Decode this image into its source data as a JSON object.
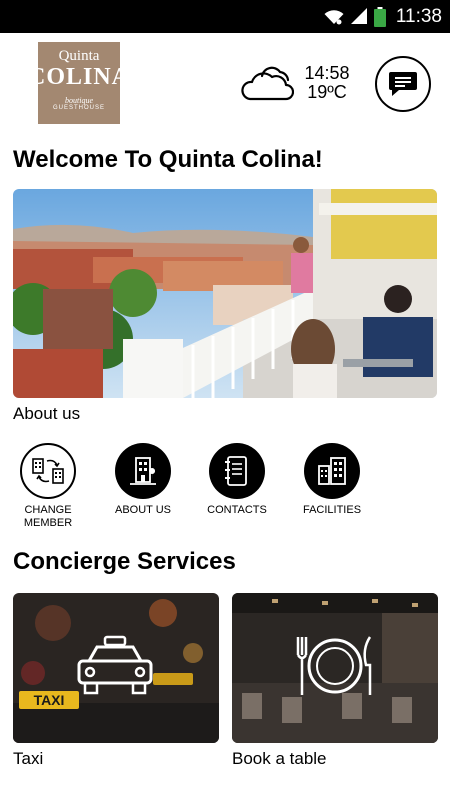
{
  "status_bar": {
    "time": "11:38",
    "icons": [
      "wifi-icon",
      "signal-icon",
      "battery-icon"
    ],
    "battery_color": "#3aa845"
  },
  "header": {
    "logo": {
      "line1": "Quinta",
      "line2": "COLINA",
      "line3": "boutique",
      "line4": "GUESTHOUSE",
      "color": "#a38871"
    },
    "weather": {
      "icon": "cloud-icon",
      "time": "14:58",
      "temperature": "19ºC"
    },
    "chat_icon": "chat-bubble-icon"
  },
  "welcome_title": "Welcome To Quinta Colina!",
  "hero": {
    "caption": "About us"
  },
  "quick_nav": [
    {
      "label": "CHANGE\nMEMBER",
      "icon": "change-member-icon"
    },
    {
      "label": "ABOUT US",
      "icon": "building-pin-icon"
    },
    {
      "label": "CONTACTS",
      "icon": "address-book-icon"
    },
    {
      "label": "FACILITIES",
      "icon": "buildings-icon"
    }
  ],
  "concierge": {
    "title": "Concierge Services",
    "cards": [
      {
        "caption": "Taxi",
        "icon": "taxi-icon"
      },
      {
        "caption": "Book a table",
        "icon": "plate-cutlery-icon"
      }
    ]
  }
}
